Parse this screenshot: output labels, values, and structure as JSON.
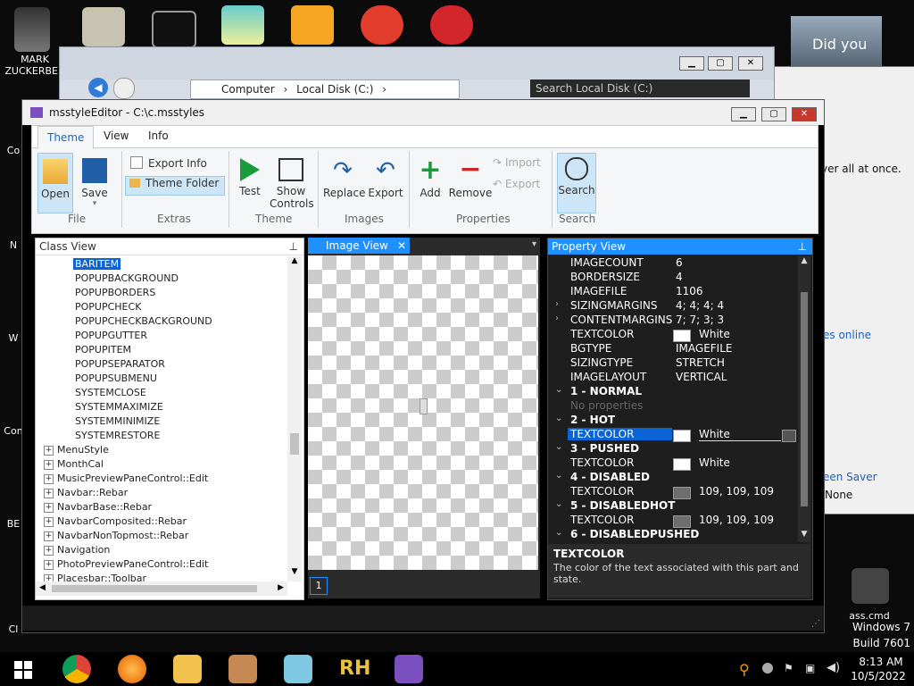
{
  "desktop": {
    "icons": [
      {
        "label": "MARK\nZUCKERBER"
      },
      {
        "label": "Co"
      },
      {
        "label": "N"
      },
      {
        "label": "W"
      },
      {
        "label": "Con"
      },
      {
        "label": "BE"
      },
      {
        "label": "Cl"
      }
    ],
    "right_labels": {
      "did_you": "Did you",
      "over_all": "ver all at once.",
      "es_online": "es online",
      "een_saver": "een Saver",
      "none": "None",
      "ass_cmd": "ass.cmd"
    }
  },
  "explorer": {
    "breadcrumb": [
      "Computer",
      "Local Disk (C:)"
    ],
    "search_placeholder": "Search Local Disk (C:)"
  },
  "window": {
    "title": "msstyleEditor - C:\\c.msstyles",
    "tabs": [
      "Theme",
      "View",
      "Info"
    ],
    "ribbon": {
      "file": {
        "open": "Open",
        "save": "Save",
        "group": "File"
      },
      "extras": {
        "export_info": "Export Info",
        "theme_folder": "Theme Folder",
        "group": "Extras"
      },
      "theme": {
        "test": "Test",
        "show_controls_1": "Show",
        "show_controls_2": "Controls",
        "group": "Theme"
      },
      "images": {
        "replace": "Replace",
        "export": "Export",
        "group": "Images"
      },
      "properties": {
        "add": "Add",
        "remove": "Remove",
        "import": "Import",
        "export": "Export",
        "group": "Properties"
      },
      "search": {
        "search": "Search",
        "group": "Search"
      }
    }
  },
  "class_view": {
    "title": "Class View",
    "items": [
      {
        "label": "BARITEM",
        "selected": true,
        "indent": 1
      },
      {
        "label": "POPUPBACKGROUND",
        "indent": 1
      },
      {
        "label": "POPUPBORDERS",
        "indent": 1
      },
      {
        "label": "POPUPCHECK",
        "indent": 1
      },
      {
        "label": "POPUPCHECKBACKGROUND",
        "indent": 1
      },
      {
        "label": "POPUPGUTTER",
        "indent": 1
      },
      {
        "label": "POPUPITEM",
        "indent": 1
      },
      {
        "label": "POPUPSEPARATOR",
        "indent": 1
      },
      {
        "label": "POPUPSUBMENU",
        "indent": 1
      },
      {
        "label": "SYSTEMCLOSE",
        "indent": 1
      },
      {
        "label": "SYSTEMMAXIMIZE",
        "indent": 1
      },
      {
        "label": "SYSTEMMINIMIZE",
        "indent": 1
      },
      {
        "label": "SYSTEMRESTORE",
        "indent": 1
      },
      {
        "label": "MenuStyle",
        "indent": 0
      },
      {
        "label": "MonthCal",
        "indent": 0
      },
      {
        "label": "MusicPreviewPaneControl::Edit",
        "indent": 0
      },
      {
        "label": "Navbar::Rebar",
        "indent": 0
      },
      {
        "label": "NavbarBase::Rebar",
        "indent": 0
      },
      {
        "label": "NavbarComposited::Rebar",
        "indent": 0
      },
      {
        "label": "NavbarNonTopmost::Rebar",
        "indent": 0
      },
      {
        "label": "Navigation",
        "indent": 0
      },
      {
        "label": "PhotoPreviewPaneControl::Edit",
        "indent": 0
      },
      {
        "label": "Placesbar::Toolbar",
        "indent": 0
      }
    ]
  },
  "image_view": {
    "tab": "Image View",
    "page": "1"
  },
  "property_view": {
    "title": "Property View",
    "rows": [
      {
        "key": "IMAGECOUNT",
        "value": "6"
      },
      {
        "key": "BORDERSIZE",
        "value": "4"
      },
      {
        "key": "IMAGEFILE",
        "value": "1106"
      },
      {
        "key": "SIZINGMARGINS",
        "value": "4; 4; 4; 4",
        "expand": true
      },
      {
        "key": "CONTENTMARGINS",
        "value": "7; 7; 3; 3",
        "expand": true
      },
      {
        "key": "TEXTCOLOR",
        "value": "White",
        "swatch": "#ffffff"
      },
      {
        "key": "BGTYPE",
        "value": "IMAGEFILE"
      },
      {
        "key": "SIZINGTYPE",
        "value": "STRETCH"
      },
      {
        "key": "IMAGELAYOUT",
        "value": "VERTICAL"
      },
      {
        "key": "1 - NORMAL",
        "group": true
      },
      {
        "key": "No properties",
        "muted": true
      },
      {
        "key": "2 - HOT",
        "group": true
      },
      {
        "key": "TEXTCOLOR",
        "value": "White",
        "swatch": "#ffffff",
        "selected": true
      },
      {
        "key": "3 - PUSHED",
        "group": true
      },
      {
        "key": "TEXTCOLOR",
        "value": "White",
        "swatch": "#ffffff"
      },
      {
        "key": "4 - DISABLED",
        "group": true
      },
      {
        "key": "TEXTCOLOR",
        "value": "109, 109, 109",
        "swatch": "#6d6d6d"
      },
      {
        "key": "5 - DISABLEDHOT",
        "group": true
      },
      {
        "key": "TEXTCOLOR",
        "value": "109, 109, 109",
        "swatch": "#6d6d6d"
      },
      {
        "key": "6 - DISABLEDPUSHED",
        "group": true
      }
    ],
    "desc_title": "TEXTCOLOR",
    "desc_text": "The color of the text associated with this part and state."
  },
  "taskbar": {
    "time": "8:13 AM",
    "date": "10/5/2022",
    "watermark_1": "Windows 7",
    "watermark_2": "Build 7601"
  },
  "colors": {
    "accent": "#1e90ff",
    "selection": "#0a64d6",
    "dark_panel": "#1e1e1e"
  }
}
